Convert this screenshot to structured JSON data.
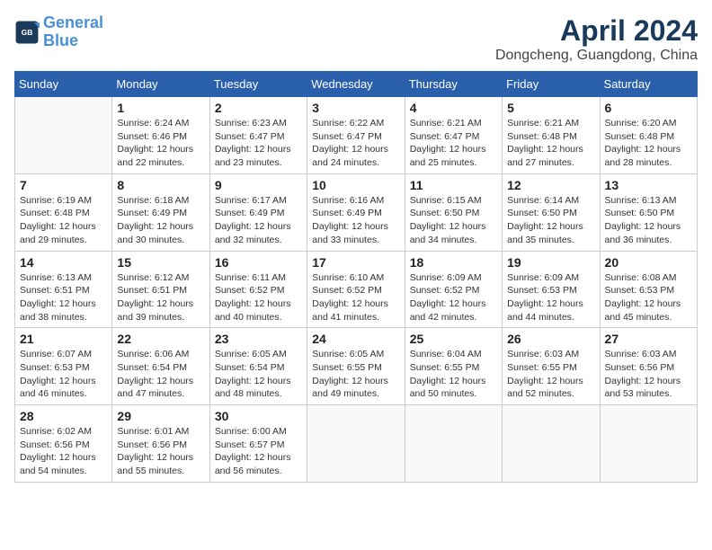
{
  "header": {
    "logo_line1": "General",
    "logo_line2": "Blue",
    "month": "April 2024",
    "location": "Dongcheng, Guangdong, China"
  },
  "weekdays": [
    "Sunday",
    "Monday",
    "Tuesday",
    "Wednesday",
    "Thursday",
    "Friday",
    "Saturday"
  ],
  "weeks": [
    [
      {
        "day": "",
        "info": ""
      },
      {
        "day": "1",
        "info": "Sunrise: 6:24 AM\nSunset: 6:46 PM\nDaylight: 12 hours\nand 22 minutes."
      },
      {
        "day": "2",
        "info": "Sunrise: 6:23 AM\nSunset: 6:47 PM\nDaylight: 12 hours\nand 23 minutes."
      },
      {
        "day": "3",
        "info": "Sunrise: 6:22 AM\nSunset: 6:47 PM\nDaylight: 12 hours\nand 24 minutes."
      },
      {
        "day": "4",
        "info": "Sunrise: 6:21 AM\nSunset: 6:47 PM\nDaylight: 12 hours\nand 25 minutes."
      },
      {
        "day": "5",
        "info": "Sunrise: 6:21 AM\nSunset: 6:48 PM\nDaylight: 12 hours\nand 27 minutes."
      },
      {
        "day": "6",
        "info": "Sunrise: 6:20 AM\nSunset: 6:48 PM\nDaylight: 12 hours\nand 28 minutes."
      }
    ],
    [
      {
        "day": "7",
        "info": "Sunrise: 6:19 AM\nSunset: 6:48 PM\nDaylight: 12 hours\nand 29 minutes."
      },
      {
        "day": "8",
        "info": "Sunrise: 6:18 AM\nSunset: 6:49 PM\nDaylight: 12 hours\nand 30 minutes."
      },
      {
        "day": "9",
        "info": "Sunrise: 6:17 AM\nSunset: 6:49 PM\nDaylight: 12 hours\nand 32 minutes."
      },
      {
        "day": "10",
        "info": "Sunrise: 6:16 AM\nSunset: 6:49 PM\nDaylight: 12 hours\nand 33 minutes."
      },
      {
        "day": "11",
        "info": "Sunrise: 6:15 AM\nSunset: 6:50 PM\nDaylight: 12 hours\nand 34 minutes."
      },
      {
        "day": "12",
        "info": "Sunrise: 6:14 AM\nSunset: 6:50 PM\nDaylight: 12 hours\nand 35 minutes."
      },
      {
        "day": "13",
        "info": "Sunrise: 6:13 AM\nSunset: 6:50 PM\nDaylight: 12 hours\nand 36 minutes."
      }
    ],
    [
      {
        "day": "14",
        "info": "Sunrise: 6:13 AM\nSunset: 6:51 PM\nDaylight: 12 hours\nand 38 minutes."
      },
      {
        "day": "15",
        "info": "Sunrise: 6:12 AM\nSunset: 6:51 PM\nDaylight: 12 hours\nand 39 minutes."
      },
      {
        "day": "16",
        "info": "Sunrise: 6:11 AM\nSunset: 6:52 PM\nDaylight: 12 hours\nand 40 minutes."
      },
      {
        "day": "17",
        "info": "Sunrise: 6:10 AM\nSunset: 6:52 PM\nDaylight: 12 hours\nand 41 minutes."
      },
      {
        "day": "18",
        "info": "Sunrise: 6:09 AM\nSunset: 6:52 PM\nDaylight: 12 hours\nand 42 minutes."
      },
      {
        "day": "19",
        "info": "Sunrise: 6:09 AM\nSunset: 6:53 PM\nDaylight: 12 hours\nand 44 minutes."
      },
      {
        "day": "20",
        "info": "Sunrise: 6:08 AM\nSunset: 6:53 PM\nDaylight: 12 hours\nand 45 minutes."
      }
    ],
    [
      {
        "day": "21",
        "info": "Sunrise: 6:07 AM\nSunset: 6:53 PM\nDaylight: 12 hours\nand 46 minutes."
      },
      {
        "day": "22",
        "info": "Sunrise: 6:06 AM\nSunset: 6:54 PM\nDaylight: 12 hours\nand 47 minutes."
      },
      {
        "day": "23",
        "info": "Sunrise: 6:05 AM\nSunset: 6:54 PM\nDaylight: 12 hours\nand 48 minutes."
      },
      {
        "day": "24",
        "info": "Sunrise: 6:05 AM\nSunset: 6:55 PM\nDaylight: 12 hours\nand 49 minutes."
      },
      {
        "day": "25",
        "info": "Sunrise: 6:04 AM\nSunset: 6:55 PM\nDaylight: 12 hours\nand 50 minutes."
      },
      {
        "day": "26",
        "info": "Sunrise: 6:03 AM\nSunset: 6:55 PM\nDaylight: 12 hours\nand 52 minutes."
      },
      {
        "day": "27",
        "info": "Sunrise: 6:03 AM\nSunset: 6:56 PM\nDaylight: 12 hours\nand 53 minutes."
      }
    ],
    [
      {
        "day": "28",
        "info": "Sunrise: 6:02 AM\nSunset: 6:56 PM\nDaylight: 12 hours\nand 54 minutes."
      },
      {
        "day": "29",
        "info": "Sunrise: 6:01 AM\nSunset: 6:56 PM\nDaylight: 12 hours\nand 55 minutes."
      },
      {
        "day": "30",
        "info": "Sunrise: 6:00 AM\nSunset: 6:57 PM\nDaylight: 12 hours\nand 56 minutes."
      },
      {
        "day": "",
        "info": ""
      },
      {
        "day": "",
        "info": ""
      },
      {
        "day": "",
        "info": ""
      },
      {
        "day": "",
        "info": ""
      }
    ]
  ]
}
